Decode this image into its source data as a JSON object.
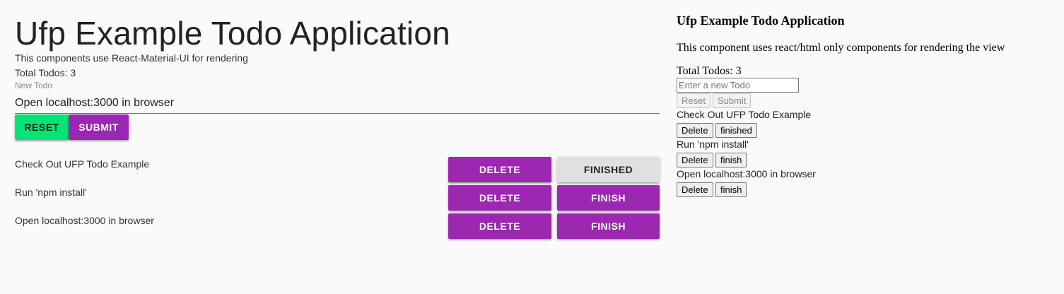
{
  "material": {
    "title": "Ufp Example Todo Application",
    "subtitle": "This components use React-Material-UI for rendering",
    "total_label": "Total Todos: 3",
    "new_todo_label": "New Todo",
    "new_todo_value": "Open localhost:3000 in browser",
    "reset_label": "RESET",
    "submit_label": "SUBMIT",
    "todos": [
      {
        "text": "Check Out UFP Todo Example",
        "delete_label": "DELETE",
        "status_label": "FINISHED"
      },
      {
        "text": "Run 'npm install'",
        "delete_label": "DELETE",
        "status_label": "FINISH"
      },
      {
        "text": "Open localhost:3000 in browser",
        "delete_label": "DELETE",
        "status_label": "FINISH"
      }
    ]
  },
  "html": {
    "title": "Ufp Example Todo Application",
    "description": "This component uses react/html only components for rendering the view",
    "total_label": "Total Todos: 3",
    "input_placeholder": "Enter a new Todo",
    "reset_label": "Reset",
    "submit_label": "Submit",
    "todos": [
      {
        "text": "Check Out UFP Todo Example",
        "delete_label": "Delete",
        "status_label": "finished"
      },
      {
        "text": "Run 'npm install'",
        "delete_label": "Delete",
        "status_label": "finish"
      },
      {
        "text": "Open localhost:3000 in browser",
        "delete_label": "Delete",
        "status_label": "finish"
      }
    ]
  },
  "colors": {
    "primary_purple": "#9c27b0",
    "accent_green": "#00e676",
    "finished_grey": "#e0e0e0",
    "background": "#fafafa"
  }
}
